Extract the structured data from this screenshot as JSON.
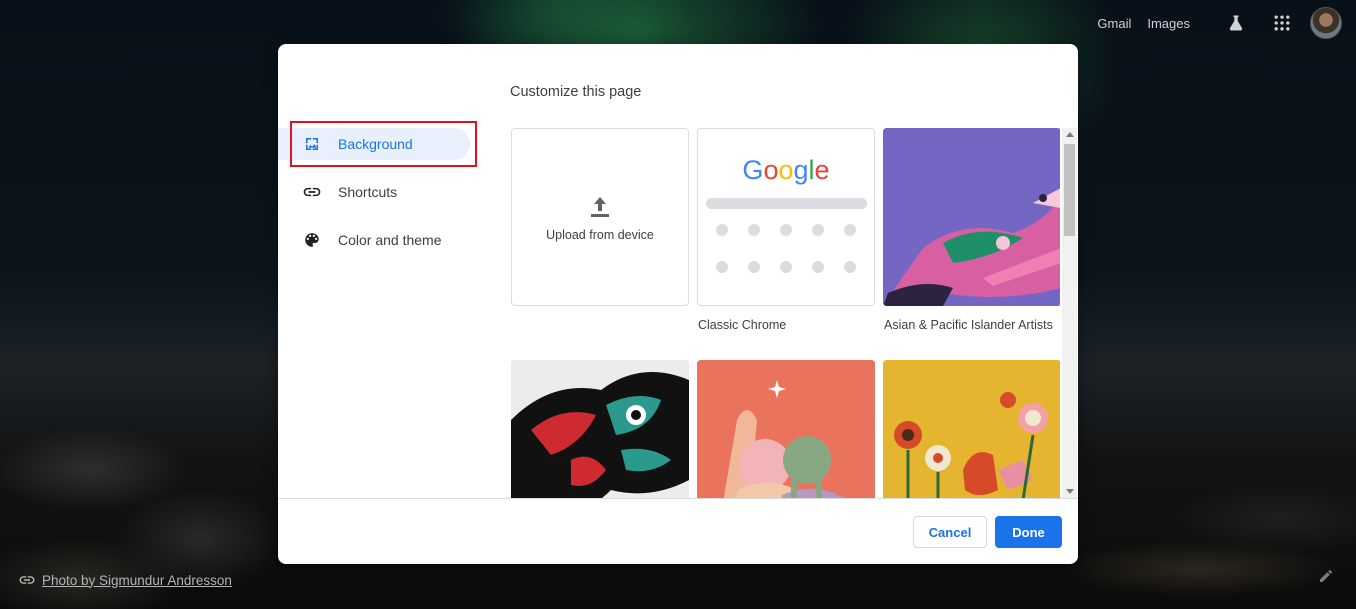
{
  "topbar": {
    "gmail": "Gmail",
    "images": "Images"
  },
  "photo_credit": "Photo by Sigmundur Andresson",
  "dialog": {
    "title": "Customize this page",
    "nav": [
      {
        "label": "Background",
        "icon": "image-icon",
        "selected": true
      },
      {
        "label": "Shortcuts",
        "icon": "link-icon",
        "selected": false
      },
      {
        "label": "Color and theme",
        "icon": "palette-icon",
        "selected": false
      }
    ],
    "tiles": {
      "upload": "Upload from device",
      "classic_logo": "Google",
      "classic_caption": "Classic Chrome",
      "asian_caption": "Asian & Pacific Islander Artists"
    },
    "buttons": {
      "cancel": "Cancel",
      "done": "Done"
    }
  },
  "colors": {
    "accent": "#1a73e8",
    "selected_bg": "#e8f0fe",
    "highlight": "#e2111b"
  }
}
